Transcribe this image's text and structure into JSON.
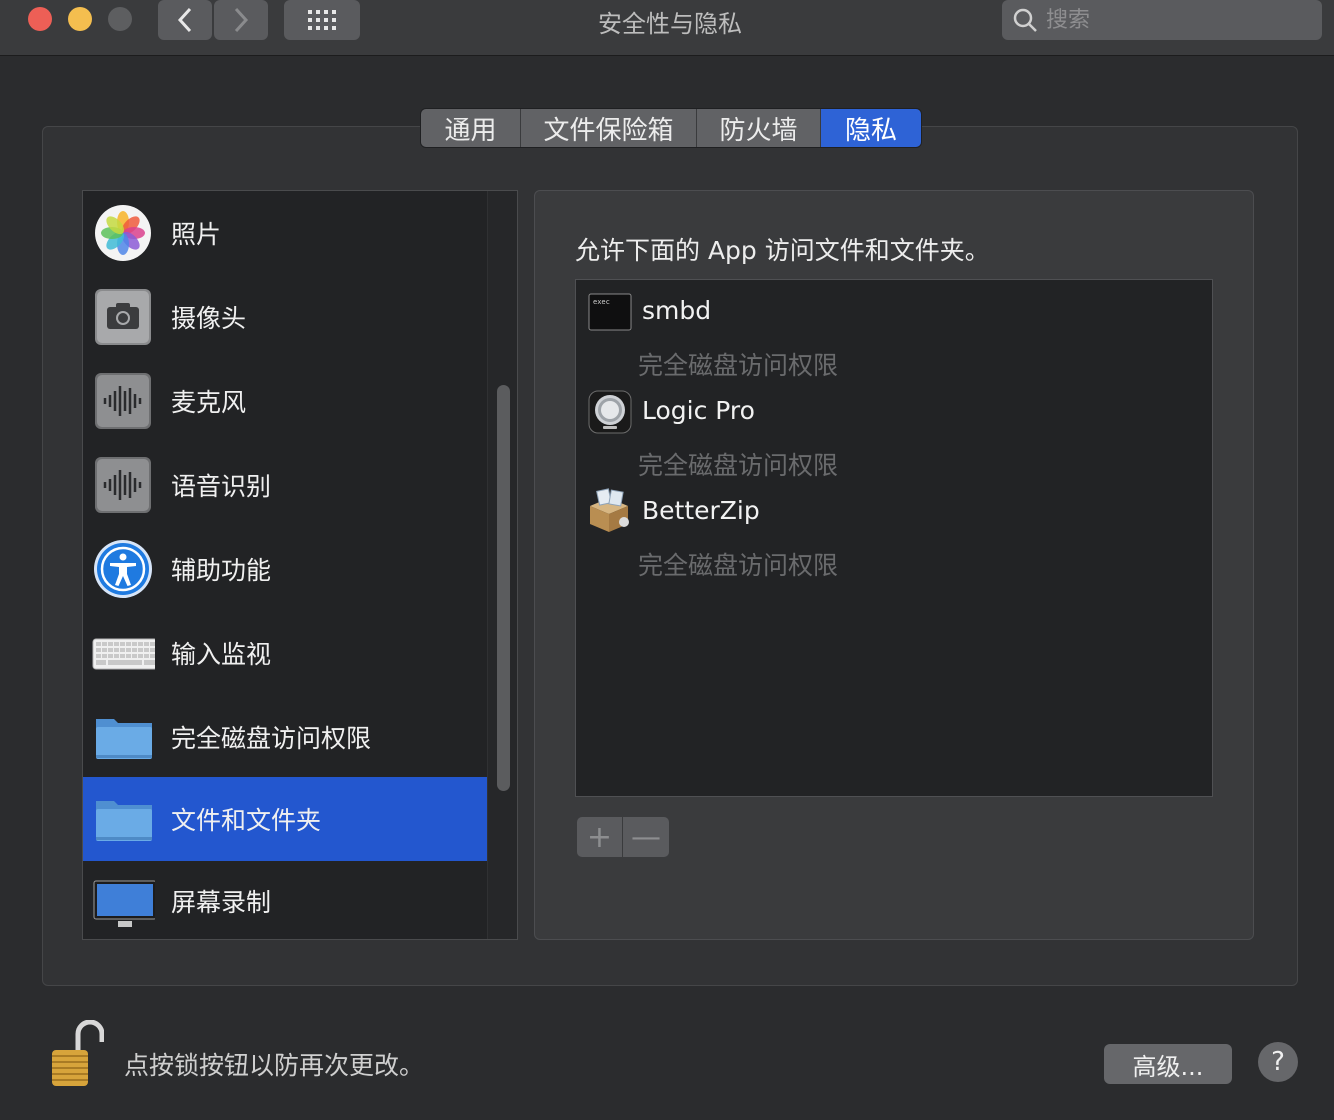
{
  "window": {
    "title": "安全性与隐私",
    "search_placeholder": "搜索"
  },
  "tabs": [
    {
      "label": "通用",
      "active": false
    },
    {
      "label": "文件保险箱",
      "active": false
    },
    {
      "label": "防火墙",
      "active": false
    },
    {
      "label": "隐私",
      "active": true
    }
  ],
  "sidebar": {
    "items": [
      {
        "label": "照片",
        "icon": "photos-icon"
      },
      {
        "label": "摄像头",
        "icon": "camera-icon"
      },
      {
        "label": "麦克风",
        "icon": "microphone-icon"
      },
      {
        "label": "语音识别",
        "icon": "speech-recognition-icon"
      },
      {
        "label": "辅助功能",
        "icon": "accessibility-icon"
      },
      {
        "label": "输入监视",
        "icon": "keyboard-icon"
      },
      {
        "label": "完全磁盘访问权限",
        "icon": "folder-icon"
      },
      {
        "label": "文件和文件夹",
        "icon": "folder-icon",
        "selected": true
      },
      {
        "label": "屏幕录制",
        "icon": "display-icon"
      }
    ]
  },
  "panel": {
    "description": "允许下面的 App 访问文件和文件夹。",
    "apps": [
      {
        "name": "smbd",
        "permission": "完全磁盘访问权限",
        "icon": "exec-terminal-icon",
        "icon_text": "exec"
      },
      {
        "name": "Logic Pro",
        "permission": "完全磁盘访问权限",
        "icon": "logic-pro-icon"
      },
      {
        "name": "BetterZip",
        "permission": "完全磁盘访问权限",
        "icon": "betterzip-icon"
      }
    ],
    "add_label": "+",
    "remove_label": "—"
  },
  "footer": {
    "lock_text": "点按锁按钮以防再次更改。",
    "advanced_label": "高级...",
    "help_label": "?"
  },
  "colors": {
    "accent": "#2357cf",
    "tab_active": "#2e63d6"
  }
}
